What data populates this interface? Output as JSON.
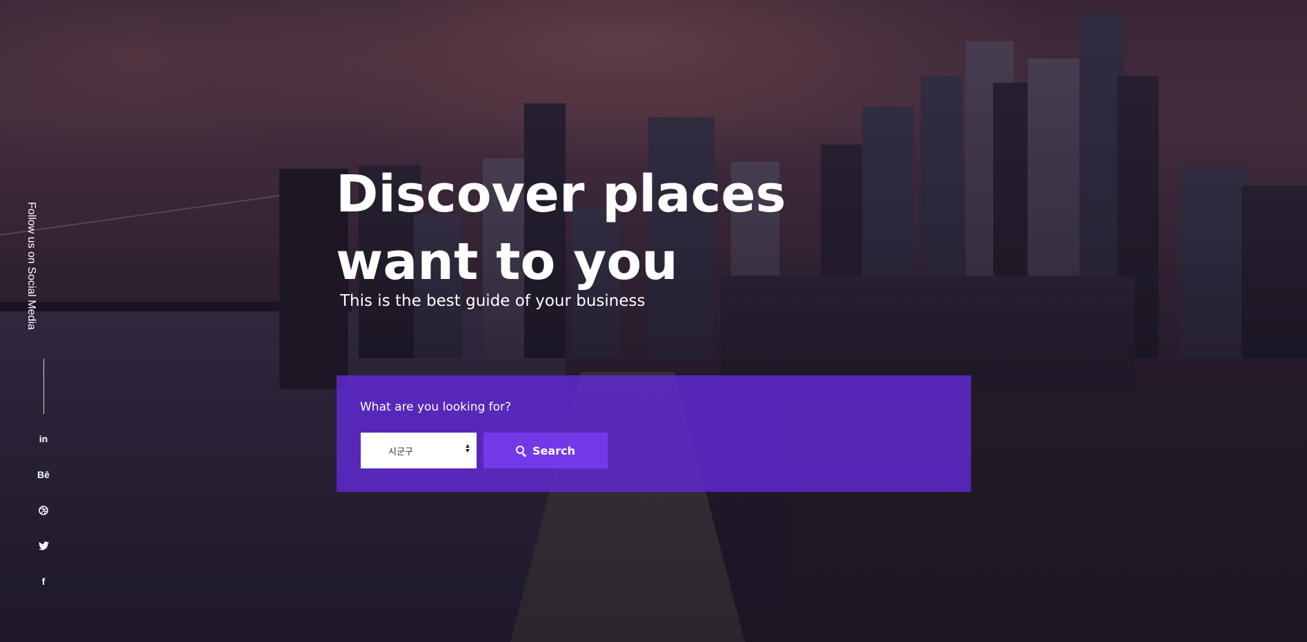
{
  "hero": {
    "headline": "Discover places want to you",
    "subtitle": "This is the best guide of your business"
  },
  "social": {
    "follow_label": "Follow us on Social Media",
    "icons": [
      {
        "name": "linkedin-icon",
        "glyph": "in"
      },
      {
        "name": "behance-icon",
        "glyph": "Bē"
      },
      {
        "name": "dribbble-icon",
        "glyph": "◍"
      },
      {
        "name": "twitter-icon",
        "glyph": "🐦"
      },
      {
        "name": "facebook-icon",
        "glyph": "f"
      }
    ]
  },
  "search": {
    "label": "What are you looking for?",
    "select_value": "시군구",
    "button_label": "Search",
    "panel_color": "#622ad6",
    "button_color": "#7339e8"
  }
}
